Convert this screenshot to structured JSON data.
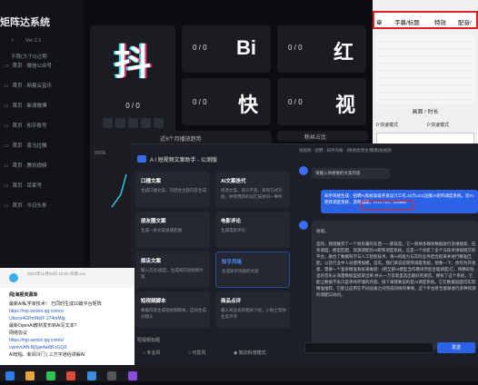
{
  "sidebar": {
    "title": "矩阵达系统",
    "version": "Ver 2.1",
    "version_prefix": "/",
    "expiry": "不限(大于0)过期",
    "items": [
      "首页 · 微信公众号",
      "首页 · 网易云音乐",
      "首页 · 新浪微博",
      "首页 · 知乎账号",
      "首页 · 喜马拉雅",
      "首页 · 腾讯视频",
      "首页 · 百家号",
      "首页 · 今日头条"
    ]
  },
  "cards": {
    "main_char": "抖",
    "main_ratio": "0 / 0",
    "small": [
      {
        "ratio": "0 / 0",
        "char": "Bi"
      },
      {
        "ratio": "0 / 0",
        "char": "红"
      },
      {
        "ratio": "0 / 0",
        "char": "快"
      },
      {
        "ratio": "0 / 0",
        "char": "视"
      }
    ]
  },
  "trend": {
    "title": "近6个月播放趋势",
    "y_label": "1000k"
  },
  "share": {
    "title": "粉丝占比"
  },
  "rpanel": {
    "tabs": [
      "章",
      "字幕/标题",
      "特效",
      "配音/"
    ],
    "scale_title": "画面 / 时长",
    "radio_a": "0 快速模式",
    "radio_b": "0 快速模式"
  },
  "dialog": {
    "title": "A I 短视频文案助手 - 公测版",
    "features": [
      {
        "title": "口播文案",
        "desc": "生成口播文案、可结合主题内容生成"
      },
      {
        "title": "AI文案迭代",
        "desc": "修改文案、语义不变，表现方式升级，并使用新的词汇描述同一事件"
      },
      {
        "title": "朋友圈文案",
        "desc": "生成一条文案发朋友圈"
      },
      {
        "title": "电影评论",
        "desc": "生成电影评论"
      },
      {
        "title": "探店文案",
        "desc": "输入店名/类型，生成探店短视频文案"
      },
      {
        "title": "知乎风格",
        "desc": "生成知乎风格的文案",
        "active": true
      },
      {
        "title": "短视频脚本",
        "desc": "根据内容生成短视频脚本，自动生成分镜头"
      },
      {
        "title": "商品点评",
        "desc": "输入商品名和相关介绍，小贴士帮你生成点评"
      }
    ],
    "chat_header": "短视频 · 招聘 · 知乎风格 · (情感类博主/健康)短视频",
    "chat_prompt": "请输入你想要的文案内容",
    "user_msg": "知乎风格生成：招聘AI系统高级开发设计工作,10万UCC国家AI矩阵调度系统。近AI矩阵调度系统、游戏加速，0707712、IZ0985",
    "bot_greet": "谢谢。",
    "bot_text": "是的，我接触到了一个很有趣的东西——那就是，它一款将多媒体数据进行多维搜索、任务调度、模型匹配、资源调配的AI矩阵调度系统。这是一个创新了多个与技术领域相交的平台，融合了数据科学与人工智能技术，将AI的能力与实际业务结合起来并进行精准匹配。以及行业中人员使用规模。首先，我们来说说矩阵调度系统。想象一下，你作为开发者，需要一个复杂精准系统来做到：(把全部AI模型当作模块然后合理调度)它，将精彩纷呈的音乐从海量数据里提取出来;并从一万首歌里选出最好的那首。拥有了这个系统，它能让数据不再只是单纯存储的内容。接下来我要说的是AI调度系统。它在数据层面可实现精准推荐。它能让应用在不同设备之间完成同样的事情，这个平台甚至能够进行多种资源的调配与协同。",
    "bottom_label": "短视频标题",
    "radio1": "专业风",
    "radio2": "可爱风",
    "radio3": "知识科普模式",
    "send_label": "发送"
  },
  "doc": {
    "title": "闻|海报资源库",
    "header": "2023年11月09日 15:05  作者:xxx",
    "lines": [
      "最新AI私学家技术！ 已同时生成10篇平台矩阵",
      "https://mp.weixin.qq.com/s/",
      "Ubsoo4GRmNkIF 374mMtg",
      "最新OpenAI教材发布到AI写文本? ",
      "网络协议",
      "https://mp.weixin.qq.com/s/",
      "cwmvcAN-Bj5ge4w8tFzGQ0",
      "AI增幅、新闻冷门 | 三万字通俗讲解AI",
      "https://mp.weixin.qq.com/s/"
    ]
  }
}
